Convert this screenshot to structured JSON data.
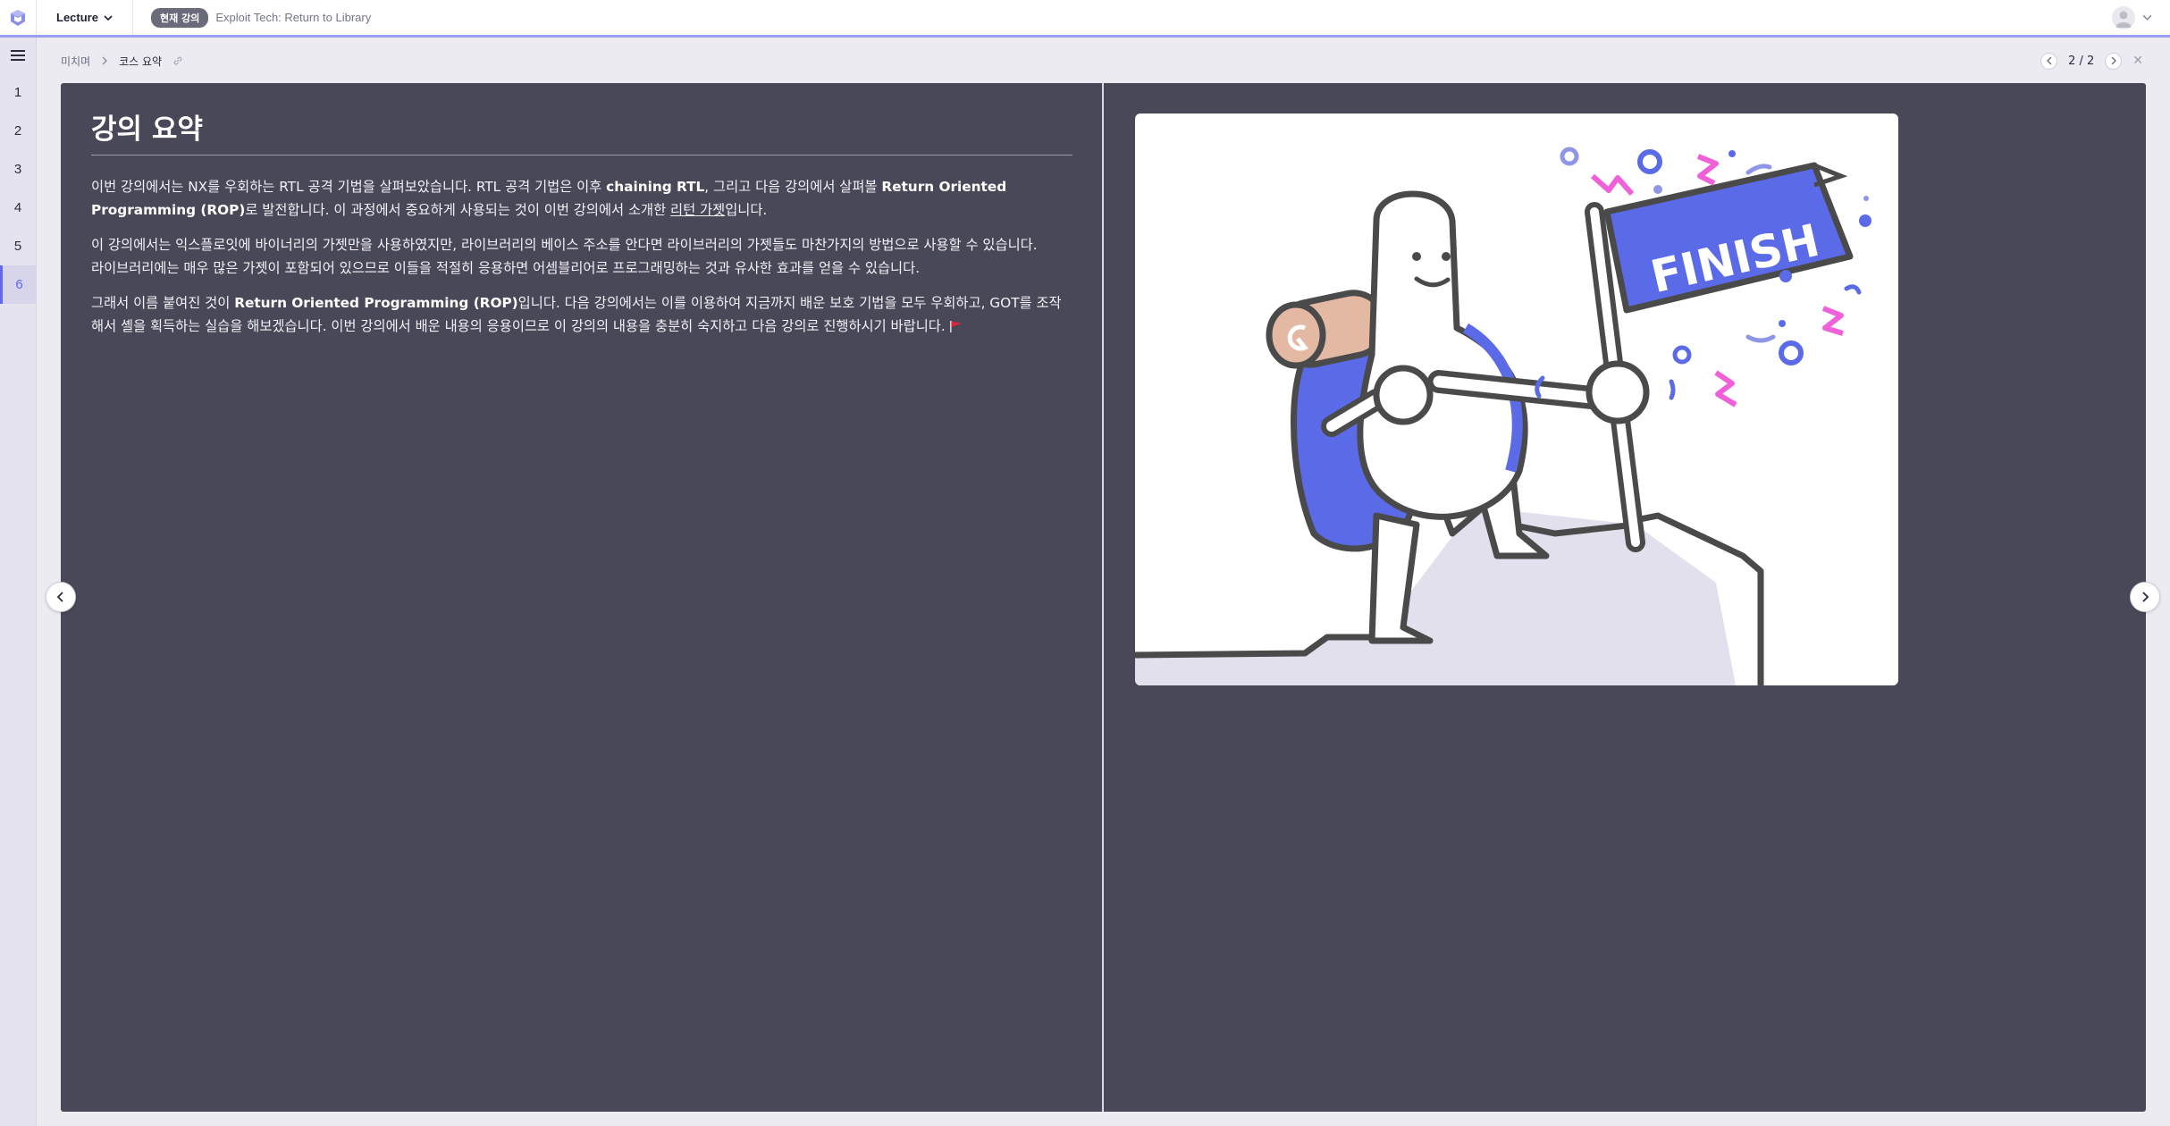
{
  "header": {
    "logo_icon": "dreamhack-cube-icon",
    "lecture_dropdown": "Lecture",
    "current_badge": "현재 강의",
    "current_title": "Exploit Tech: Return to Library"
  },
  "rail": {
    "items": [
      "1",
      "2",
      "3",
      "4",
      "5",
      "6"
    ],
    "active_index": 5
  },
  "breadcrumb": {
    "items": [
      "미치며",
      "코스 요약"
    ]
  },
  "pager": {
    "label": "2 / 2"
  },
  "slide": {
    "title": "강의 요약",
    "p1": {
      "a": "이번 강의에서는 NX를 우회하는 RTL 공격 기법을 살펴보았습니다. RTL 공격 기법은 이후 ",
      "b": "chaining RTL",
      "c": ", 그리고 다음 강의에서 살펴볼 ",
      "d": "Return Oriented Programming (ROP)",
      "e": "로 발전합니다. 이 과정에서 중요하게 사용되는 것이 이번 강의에서 소개한 ",
      "f": "리턴 가젯",
      "g": "입니다."
    },
    "p2": {
      "line1": "이 강의에서는 익스플로잇에 바이너리의 가젯만을 사용하였지만, 라이브러리의 베이스 주소를 안다면 라이브러리의 가젯들도 마찬가지의 방법으로 사용할 수 있습니다.",
      "line2": "라이브러리에는 매우 많은 가젯이 포함되어 있으므로 이들을 적절히 응용하면 어셈블리어로 프로그래밍하는 것과 유사한 효과를 얻을 수 있습니다."
    },
    "p3": {
      "a": "그래서 이름 붙여진 것이 ",
      "b": "Return Oriented Programming (ROP)",
      "c": "입니다. 다음 강의에서는 이를 이용하여 지금까지 배운 보호 기법을 모두 우회하고, GOT를 조작해서 셸을 획득하는 실습을 해보겠습니다. 이번 강의에서 배운 내용의 응용이므로 이 강의의 내용을 충분히 숙지하고 다음 강의로 진행하시기 바랍니다."
    },
    "flag_icon": "red-flag-icon",
    "illustration": {
      "flag_text": "FINISH",
      "colors": {
        "blue": "#5b6be8",
        "pink": "#f060d8",
        "tan": "#e4b9a4",
        "rock": "#e2e0ec",
        "outline": "#4a4a4a"
      }
    }
  }
}
